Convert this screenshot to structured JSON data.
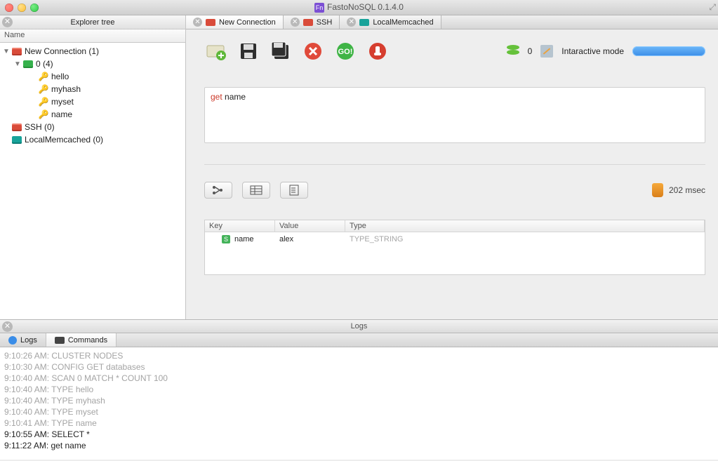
{
  "window": {
    "title": "FastoNoSQL 0.1.4.0"
  },
  "explorer": {
    "header": "Explorer tree",
    "column": "Name",
    "items": [
      {
        "label": "New Connection (1)"
      },
      {
        "label": "0 (4)"
      },
      {
        "label": "hello"
      },
      {
        "label": "myhash"
      },
      {
        "label": "myset"
      },
      {
        "label": "name"
      },
      {
        "label": "SSH (0)"
      },
      {
        "label": "LocalMemcached (0)"
      }
    ]
  },
  "tabs": [
    {
      "label": "New Connection"
    },
    {
      "label": "SSH"
    },
    {
      "label": "LocalMemcached"
    }
  ],
  "status": {
    "count": "0",
    "mode": "Intaractive mode"
  },
  "query": {
    "keyword": "get",
    "arg": "name"
  },
  "result": {
    "time": "202 msec",
    "headers": {
      "key": "Key",
      "value": "Value",
      "type": "Type"
    },
    "row": {
      "key": "name",
      "value": "alex",
      "type": "TYPE_STRING"
    }
  },
  "logs": {
    "title": "Logs",
    "tab_logs": "Logs",
    "tab_commands": "Commands",
    "lines": [
      {
        "ts": "9:10:26 AM:",
        "txt": "CLUSTER NODES",
        "active": false
      },
      {
        "ts": "9:10:30 AM:",
        "txt": "CONFIG GET databases",
        "active": false
      },
      {
        "ts": "9:10:40 AM:",
        "txt": "SCAN 0 MATCH * COUNT 100",
        "active": false
      },
      {
        "ts": "9:10:40 AM:",
        "txt": "TYPE hello",
        "active": false
      },
      {
        "ts": "9:10:40 AM:",
        "txt": "TYPE myhash",
        "active": false
      },
      {
        "ts": "9:10:40 AM:",
        "txt": "TYPE myset",
        "active": false
      },
      {
        "ts": "9:10:41 AM:",
        "txt": "TYPE name",
        "active": false
      },
      {
        "ts": "9:10:55 AM:",
        "txt": "SELECT *",
        "active": true
      },
      {
        "ts": "9:11:22 AM:",
        "txt": "get name",
        "active": true
      }
    ]
  }
}
